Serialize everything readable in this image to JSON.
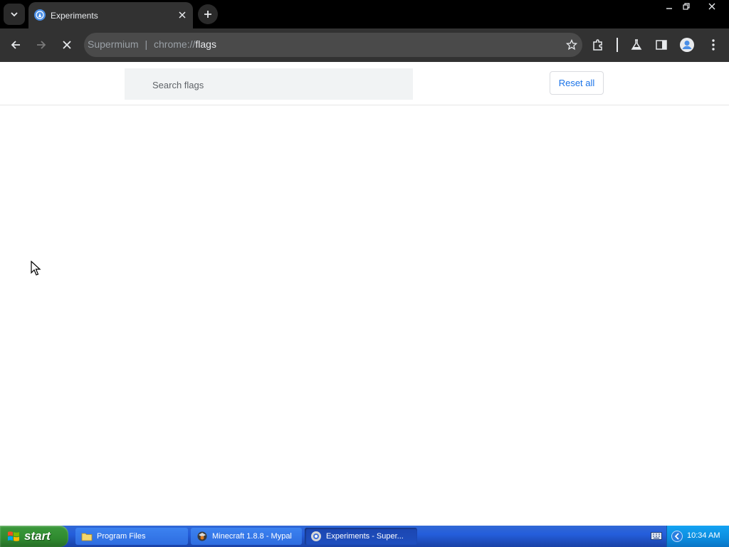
{
  "browser": {
    "tab": {
      "title": "Experiments"
    },
    "omnibox": {
      "scheme_label": "Supermium",
      "separator": "|",
      "url_prefix": "chrome://",
      "url_host": "flags"
    }
  },
  "page": {
    "search": {
      "placeholder": "Search flags"
    },
    "reset_label": "Reset all"
  },
  "taskbar": {
    "start_label": "start",
    "items": [
      {
        "label": "Program Files"
      },
      {
        "label": "Minecraft 1.8.8 - Mypal"
      },
      {
        "label": "Experiments - Super..."
      }
    ],
    "clock": "10:34 AM"
  }
}
